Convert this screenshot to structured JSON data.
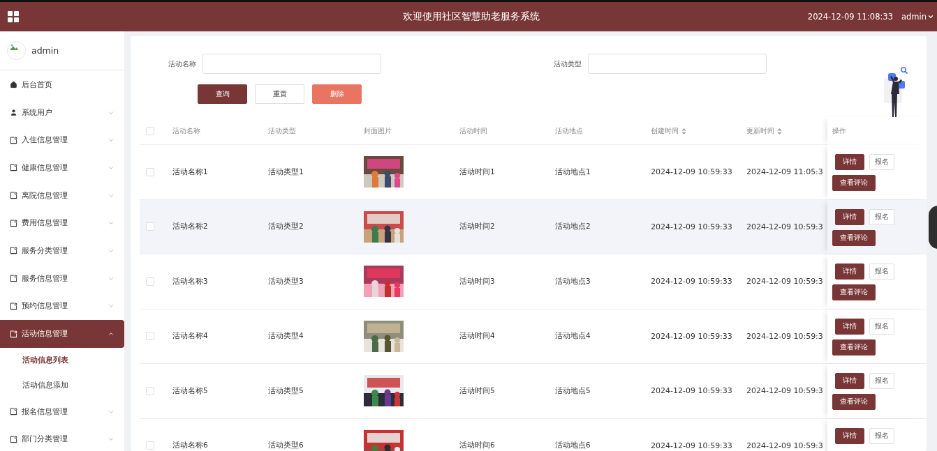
{
  "header": {
    "title": "欢迎使用社区智慧助老服务系统",
    "datetime": "2024-12-09 11:08:33",
    "user": "admin"
  },
  "sidebar": {
    "user": "admin",
    "items": [
      {
        "label": "后台首页",
        "kind": "home",
        "selected": false
      },
      {
        "label": "系统用户",
        "kind": "user",
        "selected": false,
        "expanded": false
      },
      {
        "label": "入住信息管理",
        "kind": "doc",
        "selected": false,
        "expanded": false
      },
      {
        "label": "健康信息管理",
        "kind": "doc",
        "selected": false,
        "expanded": false
      },
      {
        "label": "离院信息管理",
        "kind": "doc",
        "selected": false,
        "expanded": false
      },
      {
        "label": "费用信息管理",
        "kind": "doc",
        "selected": false,
        "expanded": false
      },
      {
        "label": "服务分类管理",
        "kind": "doc",
        "selected": false,
        "expanded": false
      },
      {
        "label": "服务信息管理",
        "kind": "doc",
        "selected": false,
        "expanded": false
      },
      {
        "label": "预约信息管理",
        "kind": "doc",
        "selected": false,
        "expanded": false
      },
      {
        "label": "活动信息管理",
        "kind": "doc",
        "selected": true,
        "expanded": true,
        "children": [
          {
            "label": "活动信息列表",
            "selected": true
          },
          {
            "label": "活动信息添加",
            "selected": false
          }
        ]
      },
      {
        "label": "报名信息管理",
        "kind": "doc",
        "selected": false,
        "expanded": false
      },
      {
        "label": "部门分类管理",
        "kind": "doc",
        "selected": false,
        "expanded": false
      }
    ]
  },
  "search": {
    "fields": [
      {
        "label": "活动名称"
      },
      {
        "label": "活动类型"
      }
    ],
    "buttons": [
      {
        "label": "查询",
        "kind": "primary"
      },
      {
        "label": "重置",
        "kind": "plain"
      },
      {
        "label": "删除",
        "kind": "danger"
      }
    ]
  },
  "table": {
    "all_checked": false,
    "columns": [
      {
        "label": "活动名称",
        "sortable": false
      },
      {
        "label": "活动类型",
        "sortable": false
      },
      {
        "label": "封面图片",
        "sortable": false
      },
      {
        "label": "活动时间",
        "sortable": false
      },
      {
        "label": "活动地点",
        "sortable": false
      },
      {
        "label": "创建时间",
        "sortable": true
      },
      {
        "label": "更新时间",
        "sortable": true
      },
      {
        "label": "操作",
        "sortable": false
      }
    ],
    "rows": [
      {
        "checked": false,
        "selected": false,
        "name": "活动名称1",
        "type": "活动类型1",
        "cover": {
          "kind": "picture"
        },
        "time": "活动时间1",
        "place": "活动地点1",
        "created": "2024-12-09 10:59:33",
        "updated": "2024-12-09 11:05:3",
        "actions": [
          {
            "label": "详情",
            "kind": "primary"
          },
          {
            "label": "报名",
            "kind": "plain"
          },
          {
            "label": "查看评论",
            "kind": "primary"
          }
        ]
      },
      {
        "checked": false,
        "selected": true,
        "name": "活动名称2",
        "type": "活动类型2",
        "cover": {
          "kind": "picture"
        },
        "time": "活动时间2",
        "place": "活动地点2",
        "created": "2024-12-09 10:59:33",
        "updated": "2024-12-09 10:59:3",
        "actions": [
          {
            "label": "详情",
            "kind": "primary"
          },
          {
            "label": "报名",
            "kind": "plain"
          },
          {
            "label": "查看评论",
            "kind": "primary"
          }
        ]
      },
      {
        "checked": false,
        "selected": false,
        "name": "活动名称3",
        "type": "活动类型3",
        "cover": {
          "kind": "picture"
        },
        "time": "活动时间3",
        "place": "活动地点3",
        "created": "2024-12-09 10:59:33",
        "updated": "2024-12-09 10:59:3",
        "actions": [
          {
            "label": "详情",
            "kind": "primary"
          },
          {
            "label": "报名",
            "kind": "plain"
          },
          {
            "label": "查看评论",
            "kind": "primary"
          }
        ]
      },
      {
        "checked": false,
        "selected": false,
        "name": "活动名称4",
        "type": "活动类型4",
        "cover": {
          "kind": "picture"
        },
        "time": "活动时间4",
        "place": "活动地点4",
        "created": "2024-12-09 10:59:33",
        "updated": "2024-12-09 10:59:3",
        "actions": [
          {
            "label": "详情",
            "kind": "primary"
          },
          {
            "label": "报名",
            "kind": "plain"
          },
          {
            "label": "查看评论",
            "kind": "primary"
          }
        ]
      },
      {
        "checked": false,
        "selected": false,
        "name": "活动名称5",
        "type": "活动类型5",
        "cover": {
          "kind": "picture"
        },
        "time": "活动时间5",
        "place": "活动地点5",
        "created": "2024-12-09 10:59:33",
        "updated": "2024-12-09 10:59:3",
        "actions": [
          {
            "label": "详情",
            "kind": "primary"
          },
          {
            "label": "报名",
            "kind": "plain"
          },
          {
            "label": "查看评论",
            "kind": "primary"
          }
        ]
      },
      {
        "checked": false,
        "selected": false,
        "name": "活动名称6",
        "type": "活动类型6",
        "cover": {
          "kind": "picture"
        },
        "time": "活动时间6",
        "place": "活动地点6",
        "created": "2024-12-09 10:59:33",
        "updated": "2024-12-09 10:59:3",
        "actions": [
          {
            "label": "详情",
            "kind": "primary"
          },
          {
            "label": "报名",
            "kind": "plain"
          }
        ]
      }
    ]
  }
}
